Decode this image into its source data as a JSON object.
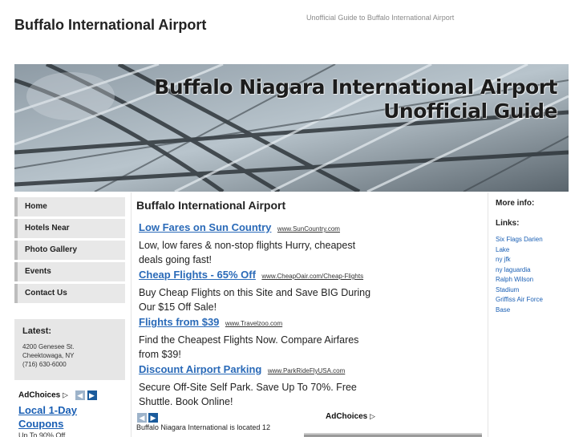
{
  "site": {
    "title": "Buffalo International Airport",
    "tagline": "Unofficial Guide to Buffalo International Airport"
  },
  "banner": {
    "line1": "Buffalo Niagara International Airport",
    "line2": "Unofficial Guide"
  },
  "nav": {
    "items": [
      {
        "label": "Home"
      },
      {
        "label": "Hotels Near"
      },
      {
        "label": "Photo Gallery"
      },
      {
        "label": "Events"
      },
      {
        "label": "Contact Us"
      }
    ]
  },
  "latest": {
    "title": "Latest:",
    "address1": "4200 Genesee St.",
    "address2": "Cheektowaga, NY",
    "phone": "(716) 630-6000"
  },
  "left_ads": {
    "adchoices": "AdChoices",
    "link_line1": "Local 1-Day",
    "link_line2": "Coupons",
    "cut_text": "Up To 90% Off"
  },
  "main": {
    "title": "Buffalo International Airport",
    "ads": [
      {
        "title": "Low Fares on Sun Country",
        "url": "www.SunCountry.com",
        "desc": "Low, low fares & non-stop flights Hurry, cheapest deals going fast!"
      },
      {
        "title": "Cheap Flights - 65% Off",
        "url": "www.CheapOair.com/Cheap-Flights",
        "desc": "Buy Cheap Flights on this Site and Save BIG During Our $15 Off Sale!"
      },
      {
        "title": "Flights from $39",
        "url": "www.Travelzoo.com",
        "desc": "Find the Cheapest Flights Now. Compare Airfares from $39!"
      },
      {
        "title": "Discount Airport Parking",
        "url": "www.ParkRideFlyUSA.com",
        "desc": "Secure Off-Site Self Park. Save Up To 70%. Free Shuttle. Book Online!"
      }
    ],
    "adchoices": "AdChoices",
    "intro": "Buffalo Niagara International is located 12"
  },
  "right": {
    "more_info": "More info:",
    "links_title": "Links:",
    "links": [
      {
        "label": "Six Flags Darien"
      },
      {
        "label": "Lake"
      },
      {
        "label": "ny jfk"
      },
      {
        "label": "ny laguardia"
      },
      {
        "label": "Ralph Wilson"
      },
      {
        "label": "Stadium"
      },
      {
        "label": "Griffiss Air Force"
      },
      {
        "label": "Base"
      }
    ]
  },
  "colors": {
    "link": "#1a5fb4",
    "ad_title": "#2a6ab8",
    "nav_bg": "#e8e8e8",
    "latest_bg": "#e6e6e6"
  }
}
